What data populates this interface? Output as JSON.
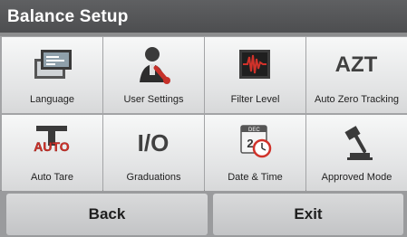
{
  "header": {
    "title": "Balance Setup"
  },
  "menu": {
    "items": [
      {
        "label": "Language",
        "icon": "language-icon"
      },
      {
        "label": "User Settings",
        "icon": "user-settings-icon"
      },
      {
        "label": "Filter Level",
        "icon": "filter-level-icon"
      },
      {
        "label": "Auto Zero Tracking",
        "icon": "auto-zero-tracking-icon",
        "icon_text": "AZT"
      },
      {
        "label": "Auto Tare",
        "icon": "auto-tare-icon",
        "icon_text": "AUTO"
      },
      {
        "label": "Graduations",
        "icon": "graduations-icon",
        "icon_text": "I/O"
      },
      {
        "label": "Date & Time",
        "icon": "date-time-icon",
        "icon_text": "DEC",
        "icon_number": "2"
      },
      {
        "label": "Approved Mode",
        "icon": "approved-mode-icon"
      }
    ]
  },
  "footer": {
    "back_label": "Back",
    "exit_label": "Exit"
  },
  "colors": {
    "titlebar": "#4f5052",
    "tile": "#ececed",
    "accent_red": "#d0322a"
  }
}
